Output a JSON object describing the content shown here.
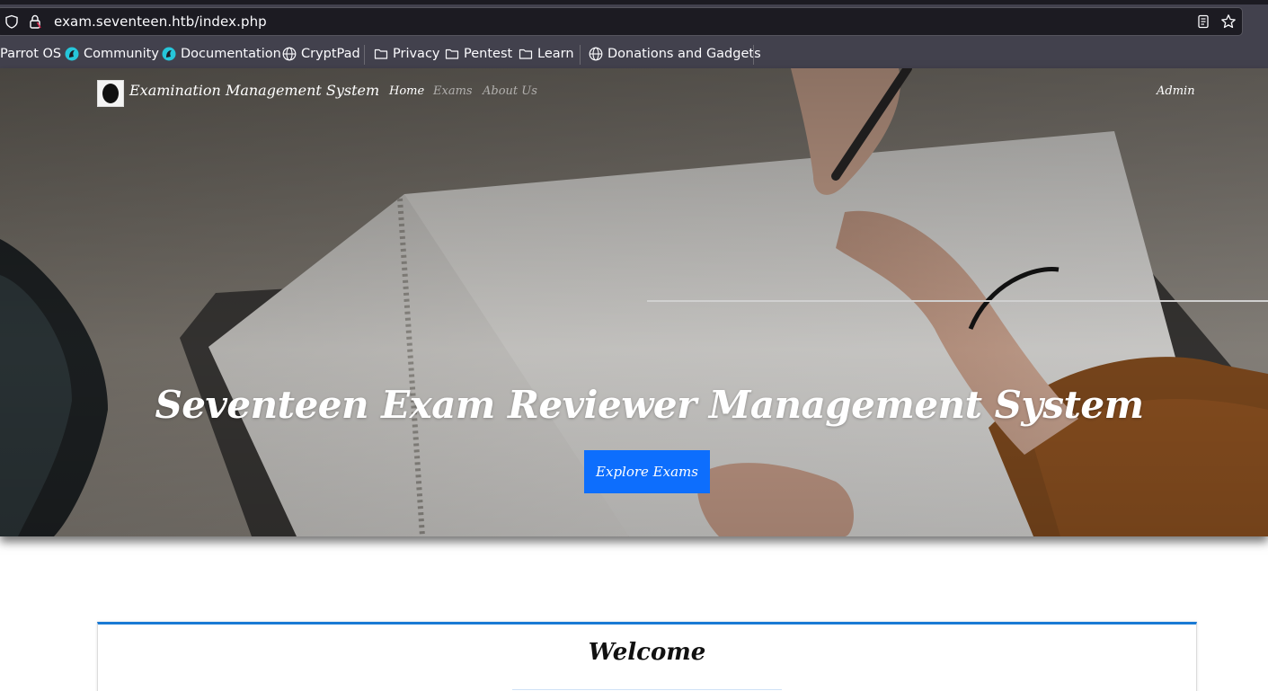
{
  "browser": {
    "url": "exam.seventeen.htb/index.php",
    "icons": {
      "shield": "shield-icon",
      "lock": "lock-icon",
      "reader": "reader-view-icon",
      "star": "bookmark-star-icon"
    },
    "bookmarks": [
      {
        "label": "Parrot OS",
        "icon": "none"
      },
      {
        "label": "Community",
        "icon": "parrot-icon"
      },
      {
        "label": "Documentation",
        "icon": "parrot-icon"
      },
      {
        "label": "CryptPad",
        "icon": "globe-icon"
      },
      {
        "label": "Privacy",
        "icon": "folder-icon"
      },
      {
        "label": "Pentest",
        "icon": "folder-icon"
      },
      {
        "label": "Learn",
        "icon": "folder-icon"
      },
      {
        "label": "Donations and Gadgets",
        "icon": "globe-icon"
      }
    ]
  },
  "navbar": {
    "brand": "Examination Management System",
    "links": [
      "Home",
      "Exams",
      "About Us"
    ],
    "active": "Home",
    "admin": "Admin"
  },
  "hero": {
    "title": "Seventeen Exam Reviewer Management System",
    "button": "Explore Exams"
  },
  "welcome": {
    "title": "Welcome"
  },
  "colors": {
    "chrome": "#42414d",
    "urlbar": "#1c1b22",
    "primary_button": "#0d6efd",
    "card_accent": "#1a7ad4"
  }
}
